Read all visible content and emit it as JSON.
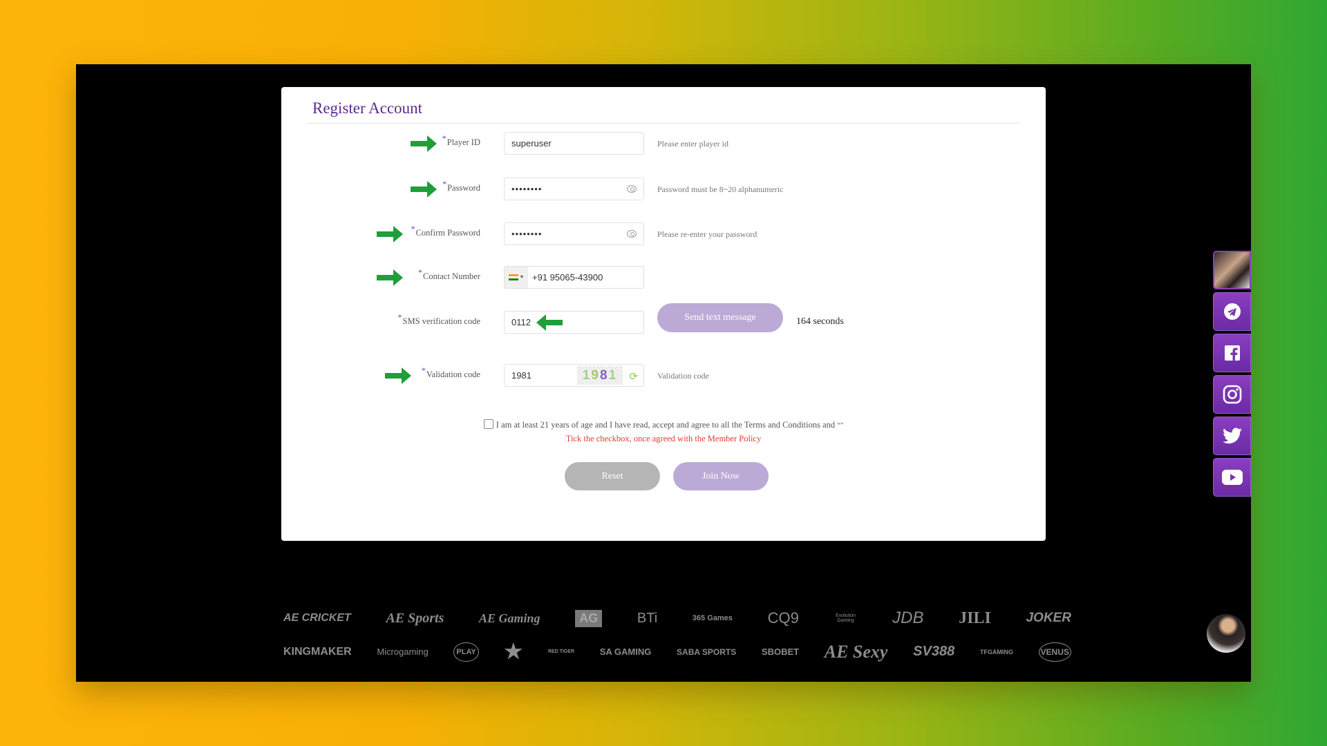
{
  "form": {
    "title": "Register Account",
    "fields": [
      {
        "label": "Player ID",
        "required_mark": "*",
        "value": "superuser",
        "hint": "Please enter player id"
      },
      {
        "label": "Password",
        "required_mark": "*",
        "value": "••••••••",
        "hint": "Password must be 8~20 alphanumeric"
      },
      {
        "label": "Confirm Password",
        "required_mark": "*",
        "value": "••••••••",
        "hint": "Please re-enter your password"
      },
      {
        "label": "Contact Number",
        "required_mark": "*",
        "value": "+91 95065-43900",
        "country": "India"
      },
      {
        "label": "SMS verification code",
        "required_mark": "*",
        "value": "0112"
      },
      {
        "label": "Validation code",
        "required_mark": "*",
        "value": "1981",
        "hint": "Validation code",
        "captcha": [
          "1",
          "9",
          "8",
          "1"
        ]
      }
    ],
    "colon": ":",
    "send_sms_label": "Send text message",
    "countdown": "164 seconds",
    "agree_text": "I am at least 21 years of age and I have read, accept and agree to all the Terms and Conditions and",
    "agree_link": "“”",
    "warning": "Tick the checkbox, once agreed with the Member Policy",
    "reset_label": "Reset",
    "join_label": "Join Now"
  },
  "social": [
    "avatar",
    "telegram-icon",
    "facebook-icon",
    "instagram-icon",
    "twitter-icon",
    "youtube-icon"
  ],
  "providers": {
    "row1": [
      "AE CRICKET",
      "AE Sports",
      "AE Gaming",
      "AG",
      "BTi",
      "365 Games",
      "CQ9",
      "Evolution Gaming",
      "JDB",
      "JILI",
      "JOKER"
    ],
    "row2": [
      "KINGMAKER",
      "Microgaming",
      "PLAY",
      "Spade",
      "RED TIGER",
      "SA GAMING",
      "SABA SPORTS",
      "SBOBET",
      "AE Sexy",
      "SV388",
      "TFGAMING",
      "VENUS"
    ]
  },
  "colors": {
    "accent": "#5b2a91",
    "button_purple": "#bcaad6",
    "button_grey": "#b5b5b5",
    "warning": "#e53935",
    "sidebar_purple": "#7b35b0",
    "arrow_green": "#1f9e3a"
  }
}
